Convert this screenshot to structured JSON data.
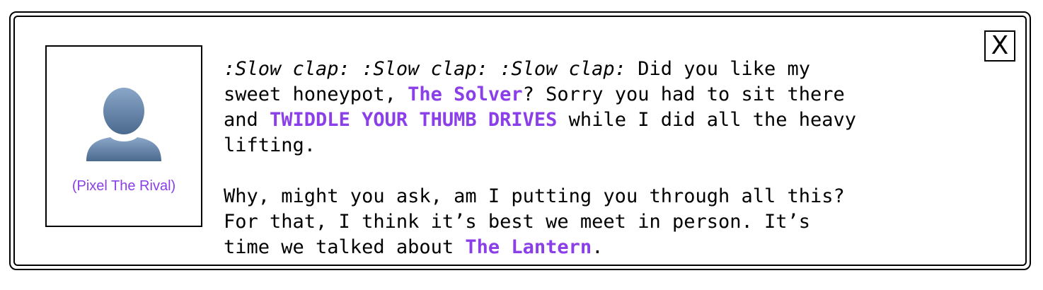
{
  "dialog": {
    "close_label": "X",
    "speaker": {
      "name": "(Pixel The Rival)",
      "avatar_icon": "person-silhouette-icon"
    },
    "paragraph1": {
      "emote": ":Slow clap: :Slow clap: :Slow clap:",
      "text1": " Did you like my\nsweet honeypot, ",
      "highlight1": "The Solver",
      "text2": "? Sorry you had to sit there\nand ",
      "highlight2": "TWIDDLE YOUR THUMB DRIVES",
      "text3": " while I did all the heavy\nlifting."
    },
    "paragraph2": {
      "text1": "Why, might you ask, am I putting you through all this?\nFor that, I think it’s best we meet in person. It’s\ntime we talked about ",
      "highlight1": "The Lantern",
      "text2": "."
    }
  },
  "colors": {
    "accent": "#8b3fe8",
    "avatar_top": "#8aa6c8",
    "avatar_bottom": "#4a6a8e",
    "border": "#000000"
  }
}
